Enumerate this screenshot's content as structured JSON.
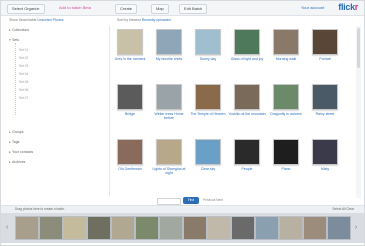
{
  "toolbar": {
    "btn1": "Select Organizr",
    "link1": "Add to batch Beta",
    "btn2": "Create",
    "btn3": "Map",
    "btn4": "Edit Batch",
    "help": "Your account",
    "logo_a": "flick",
    "logo_b": "r"
  },
  "subbar": {
    "left": "Show Searchable",
    "left_link": "Unsorted Photos",
    "mid": "Sort by Newest",
    "mid_link": "Recently uploaded"
  },
  "sidebar": {
    "items": [
      "Collections",
      "Sets",
      "Set 01",
      "Set 02",
      "Set 03",
      "Set 04",
      "Set 05",
      "Set 06",
      "Set 07",
      "Groups",
      "Tags",
      "Your contacts",
      "Archives"
    ]
  },
  "photos": [
    {
      "caption": "Grey in the moment",
      "color": "#c9c0a8"
    },
    {
      "caption": "My favorite shots",
      "color": "#8fa6b8"
    },
    {
      "caption": "Sunny day",
      "color": "#9fbfd0"
    },
    {
      "caption": "Glass of light and joy",
      "color": "#4e7a5b"
    },
    {
      "caption": "Morning walk",
      "color": "#8a7868"
    },
    {
      "caption": "Portrait",
      "color": "#5a4636"
    },
    {
      "caption": "Bridge",
      "color": "#5b5b5b"
    },
    {
      "caption": "Winter trees Home before",
      "color": "#9aa4a8"
    },
    {
      "caption": "The Temple of Heaven",
      "color": "#8a6a4a"
    },
    {
      "caption": "Yoshiko at the mountain",
      "color": "#7a6a5a"
    },
    {
      "caption": "Dragonfly in autumn",
      "color": "#6a8a6a"
    },
    {
      "caption": "Rainy street",
      "color": "#4a5a66"
    },
    {
      "caption": "Old Gentleman",
      "color": "#8a6a5a"
    },
    {
      "caption": "Lights of Shanghai at night",
      "color": "#b8a88a"
    },
    {
      "caption": "Clear sky",
      "color": "#6aa0c8"
    },
    {
      "caption": "People",
      "color": "#2a2a2a"
    },
    {
      "caption": "Piano",
      "color": "#1e1e1e"
    },
    {
      "caption": "Misty",
      "color": "#3a3a4a"
    }
  ],
  "pager": {
    "button": "Find",
    "text": "Previous Next"
  },
  "tray": {
    "left_text": "Drag photos here to create a batch",
    "right_text": "Select All  Clear",
    "strip": [
      "#a79f8c",
      "#8c8c7a",
      "#c4ba9c",
      "#6f6f60",
      "#b0a890",
      "#7a8a6a",
      "#a0a8a0",
      "#8a7a6a",
      "#c0b8a8",
      "#6a6a6a",
      "#8aa0b0",
      "#b8b0a0",
      "#9c8c7c",
      "#7c8c9c"
    ]
  },
  "colors": {
    "accent_blue": "#2c6db8",
    "accent_pink": "#e0308a"
  }
}
